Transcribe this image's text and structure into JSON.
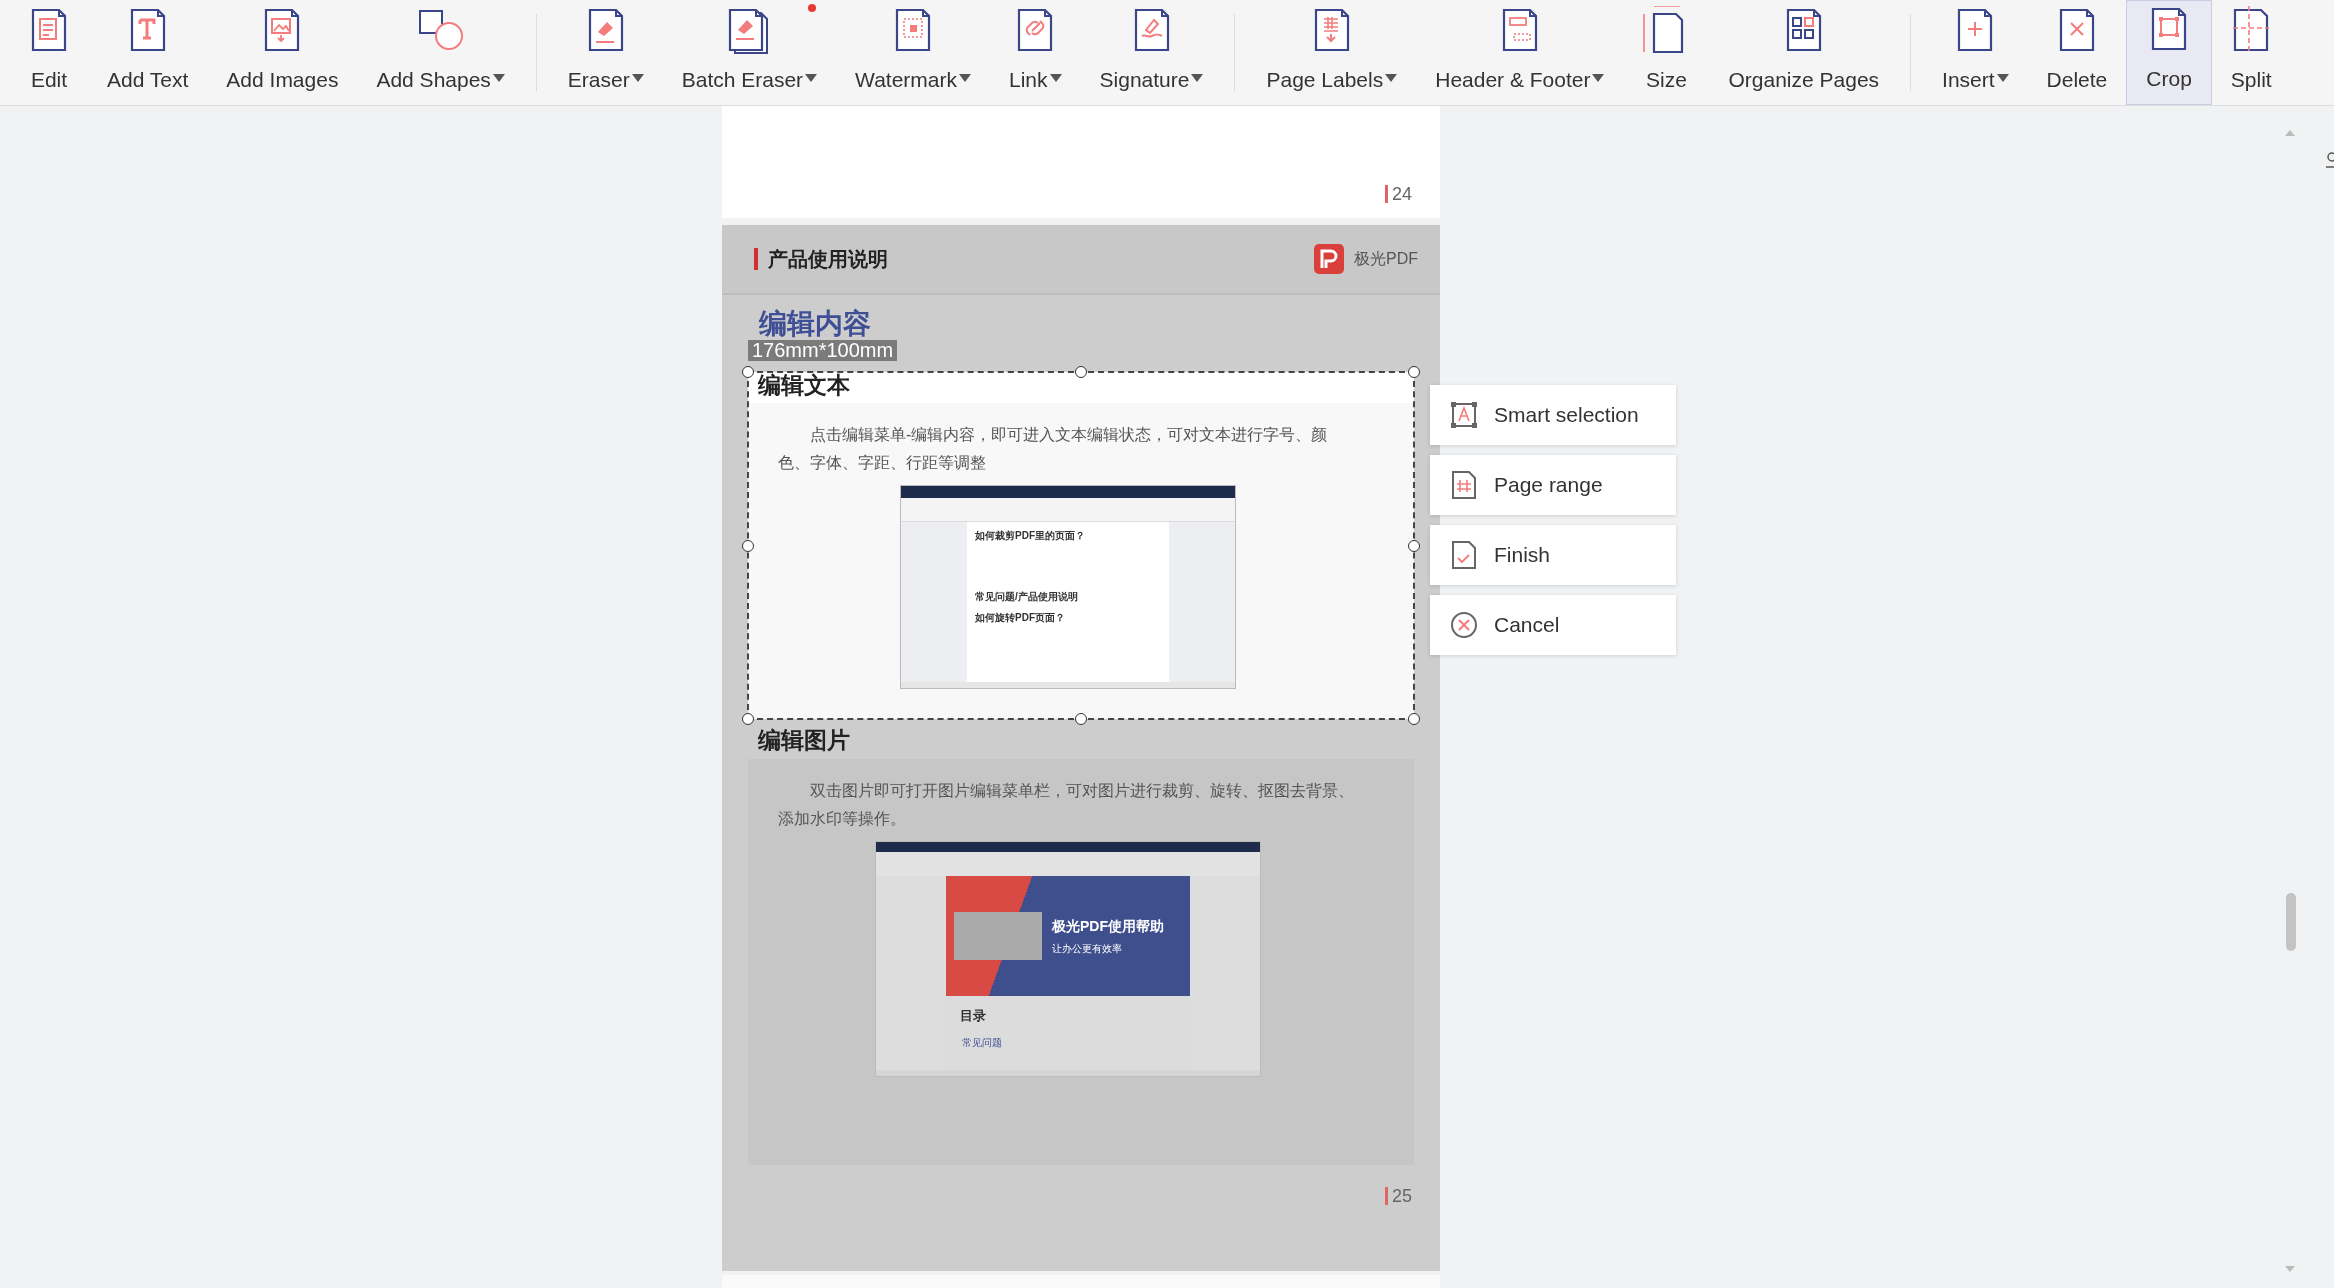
{
  "toolbar": {
    "groups": [
      [
        {
          "label": "Edit",
          "dropdown": false,
          "selected": false,
          "badge": false
        },
        {
          "label": "Add Text",
          "dropdown": false,
          "selected": false,
          "badge": false
        },
        {
          "label": "Add Images",
          "dropdown": false,
          "selected": false,
          "badge": false
        },
        {
          "label": "Add Shapes",
          "dropdown": true,
          "selected": false,
          "badge": false
        }
      ],
      [
        {
          "label": "Eraser",
          "dropdown": true,
          "selected": false,
          "badge": false
        },
        {
          "label": "Batch Eraser",
          "dropdown": true,
          "selected": false,
          "badge": true
        },
        {
          "label": "Watermark",
          "dropdown": true,
          "selected": false,
          "badge": false
        },
        {
          "label": "Link",
          "dropdown": true,
          "selected": false,
          "badge": false
        },
        {
          "label": "Signature",
          "dropdown": true,
          "selected": false,
          "badge": false
        }
      ],
      [
        {
          "label": "Page Labels",
          "dropdown": true,
          "selected": false,
          "badge": false
        },
        {
          "label": "Header & Footer",
          "dropdown": true,
          "selected": false,
          "badge": false
        },
        {
          "label": "Size",
          "dropdown": false,
          "selected": false,
          "badge": false
        },
        {
          "label": "Organize Pages",
          "dropdown": false,
          "selected": false,
          "badge": false
        }
      ],
      [
        {
          "label": "Insert",
          "dropdown": true,
          "selected": false,
          "badge": false
        },
        {
          "label": "Delete",
          "dropdown": false,
          "selected": false,
          "badge": false
        },
        {
          "label": "Crop",
          "dropdown": false,
          "selected": true,
          "badge": false
        },
        {
          "label": "Split",
          "dropdown": false,
          "selected": false,
          "badge": false
        }
      ]
    ]
  },
  "previous_page": {
    "page_number": "24"
  },
  "page": {
    "header_title": "产品使用说明",
    "brand": "极光PDF",
    "section_title": "编辑内容",
    "crop_size_label": "176mm*100mm",
    "blocks": [
      {
        "heading": "编辑文本",
        "paragraph": "点击编辑菜单-编辑内容，即可进入文本编辑状态，可对文本进行字号、颜色、字体、字距、行距等调整",
        "in_crop": true,
        "screenshot": {
          "kind": "article",
          "texts": [
            "如何裁剪PDF里的页面？",
            "常见问题/产品使用说明",
            "如何旋转PDF页面？"
          ]
        }
      },
      {
        "heading": "编辑图片",
        "paragraph": "双击图片即可打开图片编辑菜单栏，可对图片进行裁剪、旋转、抠图去背景、添加水印等操作。",
        "in_crop": false,
        "screenshot": {
          "kind": "banner",
          "texts": [
            "极光PDF使用帮助",
            "让办公更有效率",
            "目录",
            "常见问题"
          ]
        }
      }
    ],
    "page_number": "25"
  },
  "crop_menu": [
    "Smart selection",
    "Page range",
    "Finish",
    "Cancel"
  ]
}
